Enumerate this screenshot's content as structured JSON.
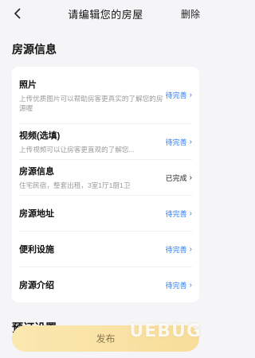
{
  "header": {
    "title": "请编辑您的房屋",
    "delete_label": "删除"
  },
  "section1": {
    "title": "房源信息",
    "rows": [
      {
        "label": "照片",
        "desc": "上传优质图片可以帮助房客更真实的了解您的房源喔",
        "status": "待完善"
      },
      {
        "label": "视频(选填)",
        "desc": "上传视频可以让房客更直观的了解您...",
        "status": "待完善"
      },
      {
        "label": "房源信息",
        "desc": "住宅民宿，整套出租，3室1厅1厨1卫",
        "status": "已完成"
      },
      {
        "label": "房源地址",
        "status": "待完善"
      },
      {
        "label": "便利设施",
        "status": "待完善"
      },
      {
        "label": "房源介绍",
        "status": "待完善"
      }
    ]
  },
  "section2": {
    "title": "预订设置"
  },
  "bottom": {
    "button_label": "发布"
  },
  "watermark": "UEBUG",
  "colors": {
    "pending": "#2f7cf6",
    "background": "#f5f5f7",
    "button": "#f7dd9a"
  }
}
